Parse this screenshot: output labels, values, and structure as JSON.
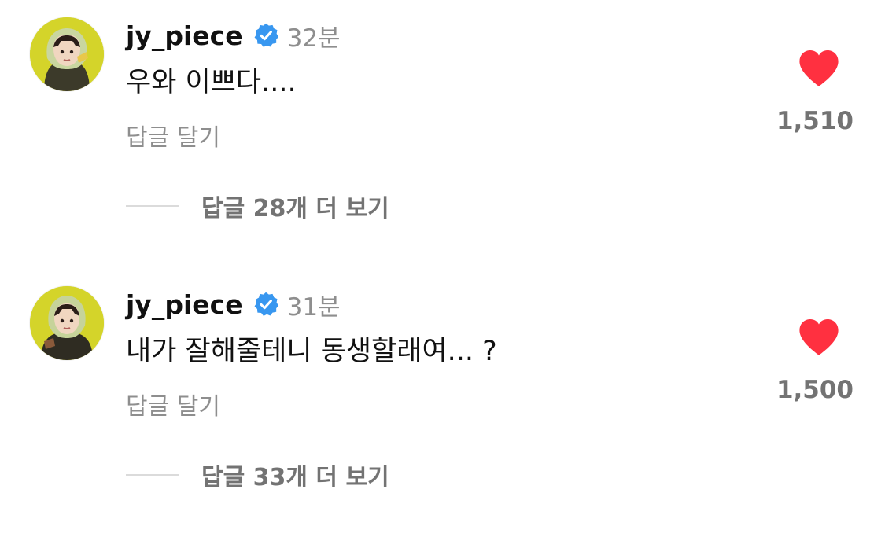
{
  "comments": [
    {
      "username": "jy_piece",
      "time": "32분",
      "text": "우와 이쁘다....",
      "reply_label": "답글 달기",
      "more_replies_label": "답글 28개 더 보기",
      "likes": "1,510",
      "liked": true
    },
    {
      "username": "jy_piece",
      "time": "31분",
      "text": "내가 잘해줄테니 동생할래여... ?",
      "reply_label": "답글 달기",
      "more_replies_label": "답글 33개 더 보기",
      "likes": "1,500",
      "liked": true
    }
  ],
  "icons": {
    "verified": "verified-badge-icon",
    "like": "heart-icon"
  },
  "colors": {
    "heart": "#ff3040",
    "verified": "#3897f0",
    "secondary_text": "#8e8e8e"
  }
}
